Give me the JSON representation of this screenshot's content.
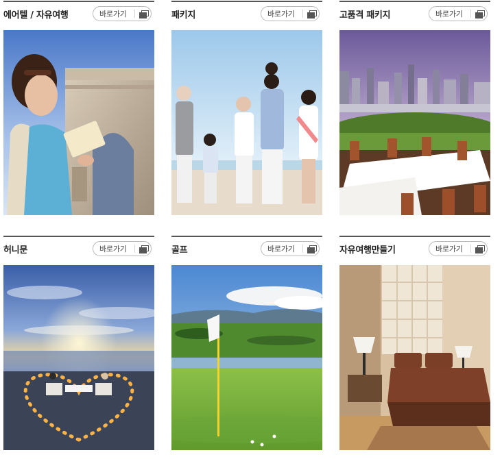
{
  "cards": [
    {
      "title": "에어텔 / 자유여행",
      "button": "바로가기"
    },
    {
      "title": "패키지",
      "button": "바로가기"
    },
    {
      "title": "고품격 패키지",
      "button": "바로가기"
    },
    {
      "title": "허니문",
      "button": "바로가기"
    },
    {
      "title": "골프",
      "button": "바로가기"
    },
    {
      "title": "자유여행만들기",
      "button": "바로가기"
    }
  ]
}
